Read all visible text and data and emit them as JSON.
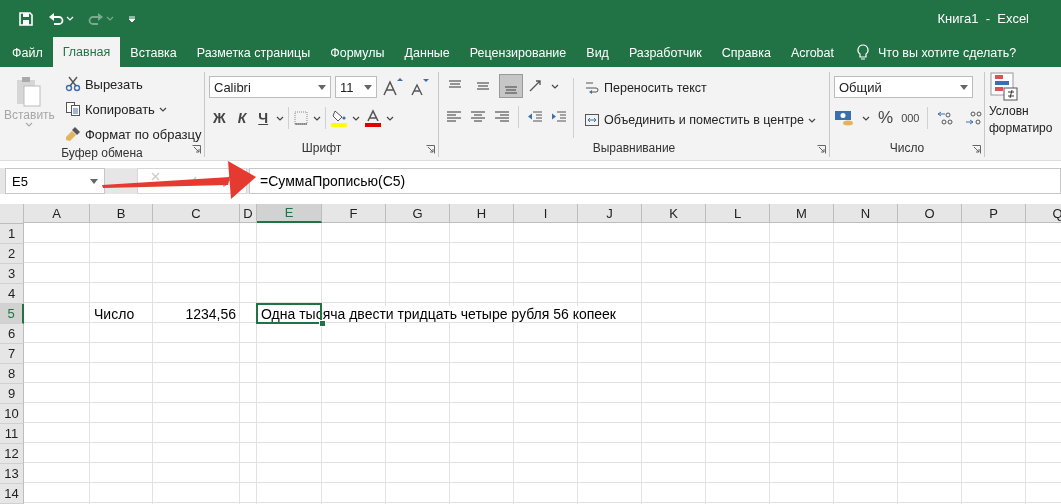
{
  "quick_access": [
    {
      "kind": "save",
      "disabled": false
    },
    {
      "kind": "undo",
      "disabled": false
    },
    {
      "kind": "redo",
      "disabled": true
    },
    {
      "kind": "customize",
      "disabled": false
    }
  ],
  "window": {
    "title": "Книга1  -  Excel"
  },
  "tabs": [
    {
      "label": "Файл",
      "selected": false
    },
    {
      "label": "Главная",
      "selected": true
    },
    {
      "label": "Вставка",
      "selected": false
    },
    {
      "label": "Разметка страницы",
      "selected": false
    },
    {
      "label": "Формулы",
      "selected": false
    },
    {
      "label": "Данные",
      "selected": false
    },
    {
      "label": "Рецензирование",
      "selected": false
    },
    {
      "label": "Вид",
      "selected": false
    },
    {
      "label": "Разработчик",
      "selected": false
    },
    {
      "label": "Справка",
      "selected": false
    },
    {
      "label": "Acrobat",
      "selected": false
    }
  ],
  "tell_me": {
    "placeholder": "Что вы хотите сделать?"
  },
  "clipboard": {
    "label": "Буфер обмена",
    "paste": {
      "label": "Вставить",
      "disabled": true
    },
    "items": [
      {
        "kind": "cut",
        "label": "Вырезать"
      },
      {
        "kind": "copy",
        "label": "Копировать"
      },
      {
        "kind": "painter",
        "label": "Формат по образцу"
      }
    ]
  },
  "font": {
    "label": "Шрифт",
    "name": "Calibri",
    "size": "11",
    "styles": [
      {
        "kind": "bold",
        "label": "Ж"
      },
      {
        "kind": "italic",
        "label": "К"
      },
      {
        "kind": "underline",
        "label": "Ч"
      }
    ]
  },
  "alignment": {
    "label": "Выравнивание",
    "vertical": [
      {
        "kind": "top",
        "selected": false
      },
      {
        "kind": "middle",
        "selected": false
      },
      {
        "kind": "bottom",
        "selected": true
      }
    ],
    "wrap": "Переносить текст",
    "merge": "Объединить и поместить в центре"
  },
  "number": {
    "label": "Число",
    "format": "Общий",
    "percent": "%",
    "thousands": "000"
  },
  "styles": {
    "conditional": [
      "Условн",
      "форматиро"
    ]
  },
  "formula_bar": {
    "name_box": "E5",
    "formula": "=СуммаПрописью(C5)"
  },
  "sheet": {
    "columns": [
      {
        "label": "A",
        "selected": false
      },
      {
        "label": "B",
        "selected": false
      },
      {
        "label": "C",
        "selected": false
      },
      {
        "label": "D",
        "selected": false
      },
      {
        "label": "E",
        "selected": true
      },
      {
        "label": "F",
        "selected": false
      },
      {
        "label": "G",
        "selected": false
      },
      {
        "label": "H",
        "selected": false
      },
      {
        "label": "I",
        "selected": false
      },
      {
        "label": "J",
        "selected": false
      },
      {
        "label": "K",
        "selected": false
      },
      {
        "label": "L",
        "selected": false
      },
      {
        "label": "M",
        "selected": false
      },
      {
        "label": "N",
        "selected": false
      },
      {
        "label": "O",
        "selected": false
      },
      {
        "label": "P",
        "selected": false
      },
      {
        "label": "Q",
        "selected": false
      }
    ],
    "rows": [
      {
        "label": "1",
        "selected": false
      },
      {
        "label": "2",
        "selected": false
      },
      {
        "label": "3",
        "selected": false
      },
      {
        "label": "4",
        "selected": false
      },
      {
        "label": "5",
        "selected": true,
        "cells": [
          {
            "kind": "empty"
          },
          {
            "kind": "text",
            "text": "Число"
          },
          {
            "kind": "number",
            "text": "1234,56"
          },
          {
            "kind": "empty"
          },
          {
            "kind": "text",
            "text": "Одна тысяча двести тридцать четыре рубля 56 копеек",
            "selected": true
          }
        ]
      },
      {
        "label": "6",
        "selected": false
      },
      {
        "label": "7",
        "selected": false
      },
      {
        "label": "8",
        "selected": false
      },
      {
        "label": "9",
        "selected": false
      },
      {
        "label": "10",
        "selected": false
      },
      {
        "label": "11",
        "selected": false
      },
      {
        "label": "12",
        "selected": false
      },
      {
        "label": "13",
        "selected": false
      },
      {
        "label": "14",
        "selected": false
      }
    ]
  }
}
